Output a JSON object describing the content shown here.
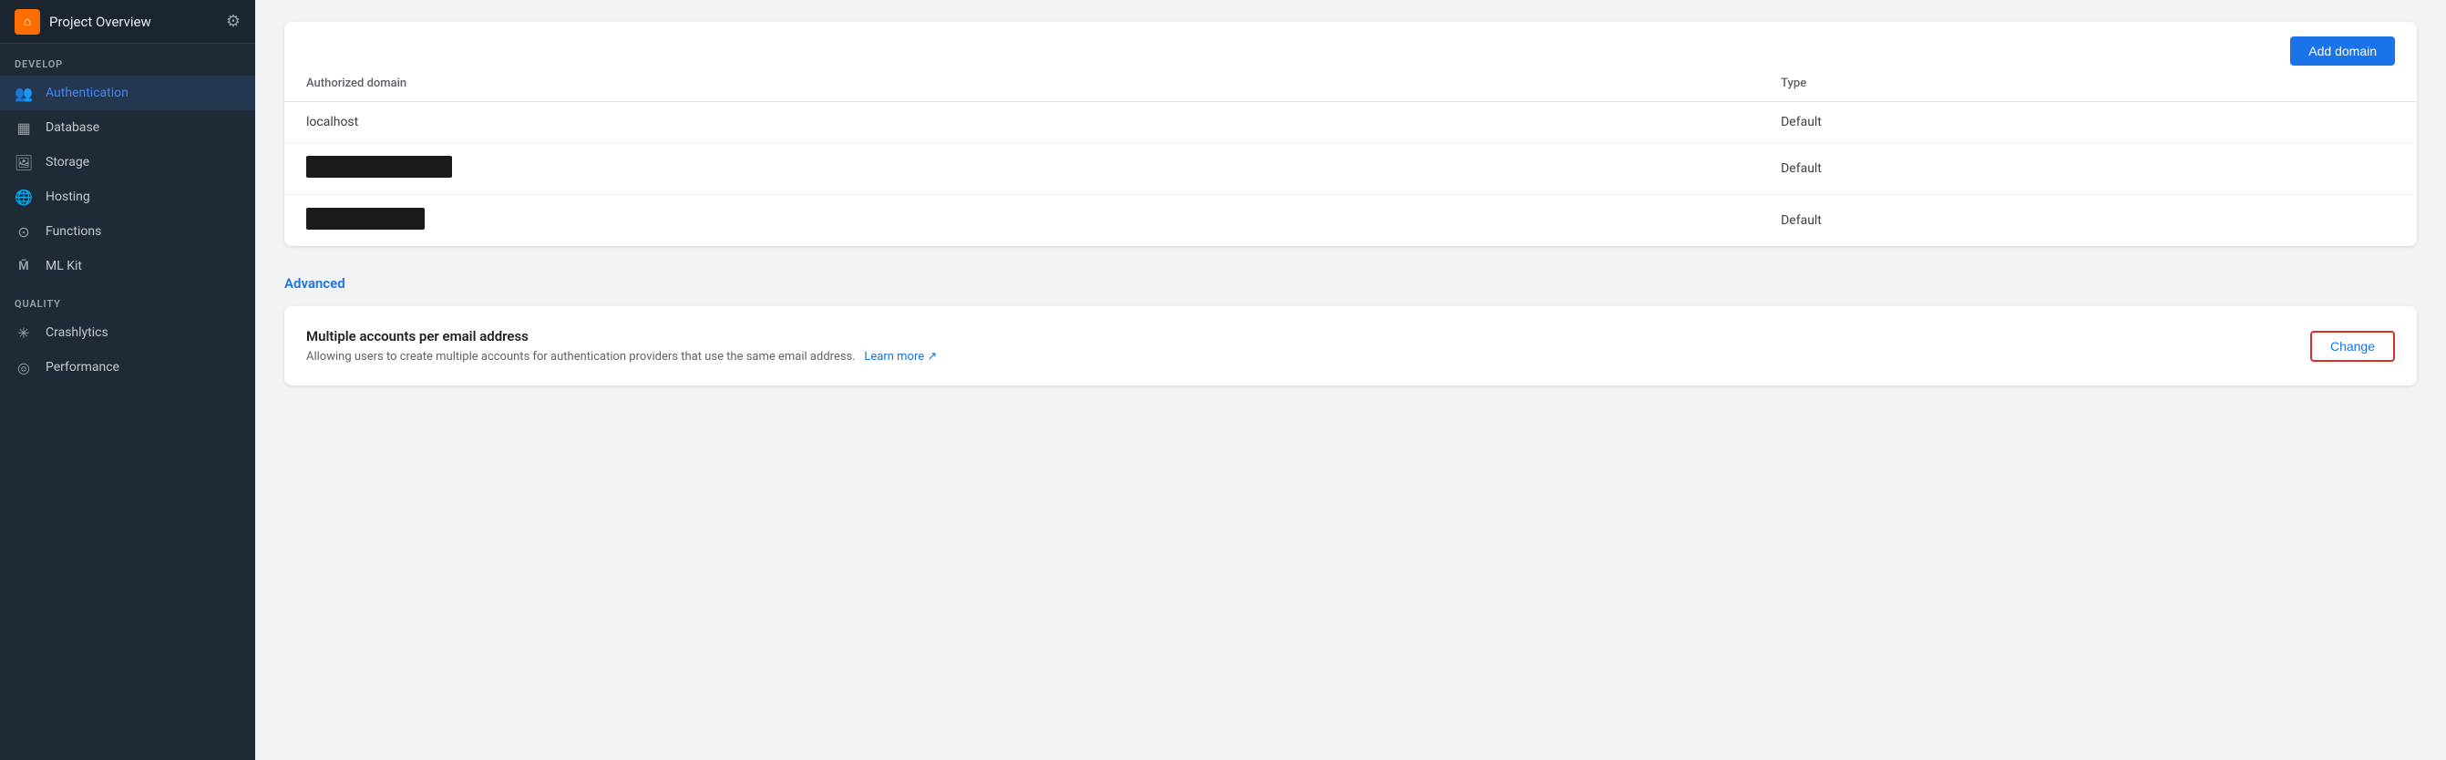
{
  "sidebar": {
    "header": {
      "title": "Project Overview",
      "gear_icon": "⚙",
      "home_icon": "⌂"
    },
    "sections": [
      {
        "label": "Develop",
        "items": [
          {
            "id": "authentication",
            "label": "Authentication",
            "icon": "👥",
            "active": true
          },
          {
            "id": "database",
            "label": "Database",
            "icon": "▦",
            "active": false
          },
          {
            "id": "storage",
            "label": "Storage",
            "icon": "🖼",
            "active": false
          },
          {
            "id": "hosting",
            "label": "Hosting",
            "icon": "🌐",
            "active": false
          },
          {
            "id": "functions",
            "label": "Functions",
            "icon": "⊙",
            "active": false
          },
          {
            "id": "ml-kit",
            "label": "ML Kit",
            "icon": "M",
            "active": false
          }
        ]
      },
      {
        "label": "Quality",
        "items": [
          {
            "id": "crashlytics",
            "label": "Crashlytics",
            "icon": "✳",
            "active": false
          },
          {
            "id": "performance",
            "label": "Performance",
            "icon": "⊙",
            "active": false
          }
        ]
      }
    ]
  },
  "main": {
    "table": {
      "columns": [
        "Authorized domain",
        "Type"
      ],
      "rows": [
        {
          "domain": "localhost",
          "type": "Default",
          "redacted": false
        },
        {
          "domain": "",
          "type": "Default",
          "redacted": true,
          "size": "large"
        },
        {
          "domain": "",
          "type": "Default",
          "redacted": true,
          "size": "small"
        }
      ]
    },
    "add_domain_label": "Add domain",
    "advanced_section": {
      "label": "Advanced",
      "card": {
        "title": "Multiple accounts per email address",
        "description": "Allowing users to create multiple accounts for authentication providers that use the same email address.",
        "learn_more_label": "Learn more",
        "learn_more_icon": "↗",
        "change_label": "Change"
      }
    }
  }
}
